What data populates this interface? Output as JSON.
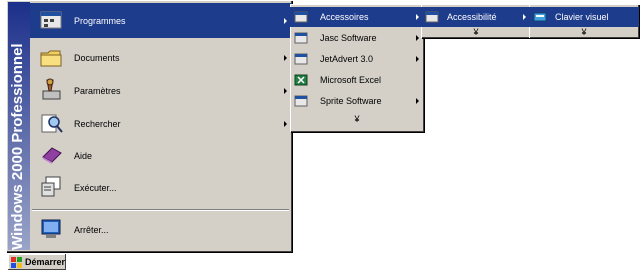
{
  "start_menu": {
    "banner": "Windows 2000 Professionnel",
    "items": [
      {
        "label": "Programmes",
        "icon": "programs-icon"
      },
      {
        "label": "Documents",
        "icon": "folder-icon"
      },
      {
        "label": "Paramètres",
        "icon": "settings-icon"
      },
      {
        "label": "Rechercher",
        "icon": "search-icon"
      },
      {
        "label": "Aide",
        "icon": "help-icon"
      },
      {
        "label": "Exécuter...",
        "icon": "run-icon"
      },
      {
        "label": "Arrêter...",
        "icon": "shutdown-icon"
      }
    ]
  },
  "programs_menu": {
    "items": [
      {
        "label": "Accessoires",
        "icon": "program-group-icon"
      },
      {
        "label": "Jasc Software",
        "icon": "program-group-icon"
      },
      {
        "label": "JetAdvert 3.0",
        "icon": "program-group-icon"
      },
      {
        "label": "Microsoft Excel",
        "icon": "excel-icon"
      },
      {
        "label": "Sprite Software",
        "icon": "program-group-icon"
      }
    ],
    "more": "¥"
  },
  "accessories_menu": {
    "items": [
      {
        "label": "Accessibilité",
        "icon": "program-group-icon"
      }
    ],
    "more": "¥"
  },
  "accessibility_menu": {
    "items": [
      {
        "label": "Clavier visuel",
        "icon": "keyboard-icon"
      }
    ],
    "more": "¥"
  },
  "taskbar": {
    "start_label": "Démarrer"
  },
  "colors": {
    "menu_bg": "#d4d0c8",
    "highlight": "#1e3c8c",
    "banner_top": "#1c2f8a",
    "banner_bottom": "#9aa4c8"
  }
}
